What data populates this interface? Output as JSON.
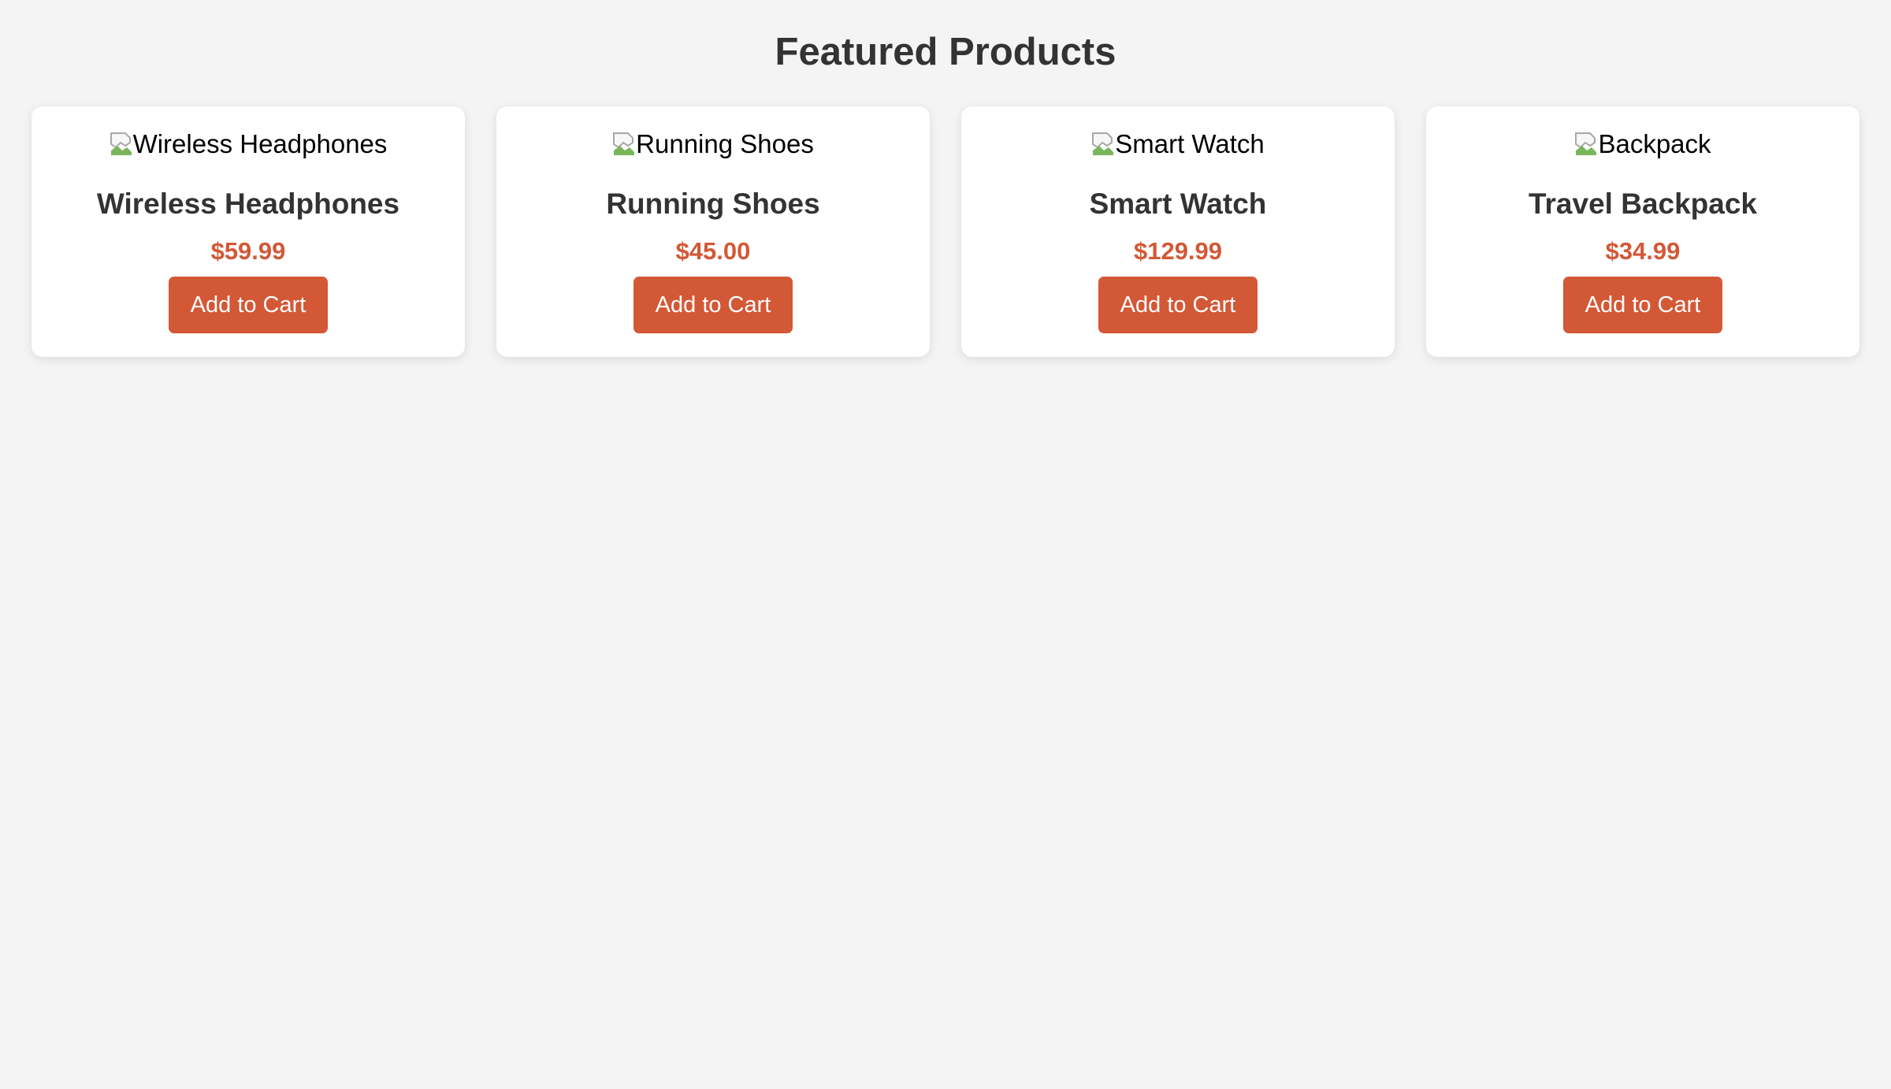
{
  "page": {
    "title": "Featured Products"
  },
  "products": [
    {
      "image_alt": "Wireless Headphones",
      "name": "Wireless Headphones",
      "price": "$59.99",
      "button_label": "Add to Cart"
    },
    {
      "image_alt": "Running Shoes",
      "name": "Running Shoes",
      "price": "$45.00",
      "button_label": "Add to Cart"
    },
    {
      "image_alt": "Smart Watch",
      "name": "Smart Watch",
      "price": "$129.99",
      "button_label": "Add to Cart"
    },
    {
      "image_alt": "Backpack",
      "name": "Travel Backpack",
      "price": "$34.99",
      "button_label": "Add to Cart"
    }
  ],
  "colors": {
    "background": "#f4f4f4",
    "card": "#ffffff",
    "accent": "#d35836",
    "text": "#333333"
  },
  "icons": {
    "image_placeholder": "broken-image-icon"
  }
}
